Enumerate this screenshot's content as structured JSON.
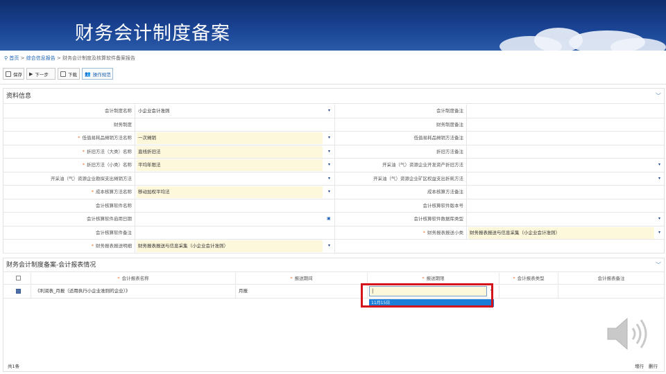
{
  "slide": {
    "title": "财务会计制度备案"
  },
  "breadcrumb": {
    "home": "首页",
    "sep": ">",
    "level1": "综合信息报告",
    "level2": "财务会计制度及核算软件备案报告"
  },
  "toolbar": {
    "save": "保存",
    "next": "下一步",
    "download": "下载",
    "guide": "操作规范"
  },
  "section1": {
    "title": "资料信息"
  },
  "form": [
    {
      "l1": "会计制度名称",
      "r1": false,
      "v1": "小企业会计准则",
      "y1": false,
      "dd1": true,
      "l2": "会计制度备注",
      "r2": false,
      "v2": "",
      "y2": false,
      "dd2": false
    },
    {
      "l1": "财务制度",
      "r1": false,
      "v1": "",
      "y1": false,
      "dd1": false,
      "l2": "财务制度备注",
      "r2": false,
      "v2": "",
      "y2": false,
      "dd2": false
    },
    {
      "l1": "低值易耗品摊销方法名称",
      "r1": true,
      "v1": "一次摊销",
      "y1": true,
      "dd1": true,
      "l2": "低值易耗品摊销方法备注",
      "r2": false,
      "v2": "",
      "y2": false,
      "dd2": false
    },
    {
      "l1": "折旧方法（大类）名称",
      "r1": true,
      "v1": "直线折旧法",
      "y1": true,
      "dd1": true,
      "l2": "折旧方法备注",
      "r2": false,
      "v2": "",
      "y2": false,
      "dd2": false
    },
    {
      "l1": "折旧方法（小类）名称",
      "r1": true,
      "v1": "平均年限法",
      "y1": true,
      "dd1": true,
      "l2": "开采油（气）资源企业开发资产折旧方法",
      "r2": false,
      "v2": "",
      "y2": false,
      "dd2": true
    },
    {
      "l1": "开采油（气）资源企业勘探支出摊销方法",
      "r1": false,
      "v1": "",
      "y1": false,
      "dd1": true,
      "l2": "开采油（气）资源企业矿区权益支出折耗方法",
      "r2": false,
      "v2": "",
      "y2": false,
      "dd2": true
    },
    {
      "l1": "成本核算方法名称",
      "r1": true,
      "v1": "移动加权平均法",
      "y1": true,
      "dd1": true,
      "l2": "成本核算方法备注",
      "r2": false,
      "v2": "",
      "y2": false,
      "dd2": false
    },
    {
      "l1": "会计核算软件名称",
      "r1": false,
      "v1": "",
      "y1": false,
      "dd1": false,
      "l2": "会计核算软件版本号",
      "r2": false,
      "v2": "",
      "y2": false,
      "dd2": false
    },
    {
      "l1": "会计核算软件启用日期",
      "r1": false,
      "v1": "",
      "y1": false,
      "dd1": false,
      "cal1": true,
      "l2": "会计核算软件数据库类型",
      "r2": false,
      "v2": "",
      "y2": false,
      "dd2": true
    },
    {
      "l1": "会计核算软件备注",
      "r1": false,
      "v1": "",
      "y1": false,
      "dd1": false,
      "l2": "财务报表报送小类",
      "r2": true,
      "v2": "财务报表报送与信息采集（小企业会计准则）",
      "y2": true,
      "dd2": true
    },
    {
      "l1": "财务报表报送明细",
      "r1": true,
      "v1": "财务报表报送与信息采集（小企业会计准则）",
      "y1": true,
      "dd1": true,
      "l2": "",
      "r2": false,
      "v2": "",
      "y2": false,
      "dd2": false,
      "half": true
    }
  ],
  "section2": {
    "title": "财务会计制度备案-会计报表情况"
  },
  "grid": {
    "headers": {
      "name": "会计报表名称",
      "period": "报送期间",
      "deadline": "报送期限",
      "type": "会计报表类型",
      "remark": "会计报表备注"
    },
    "rows": [
      {
        "name": "《利润表_月报（适用执行小企业准则的企业）》",
        "period": "月报",
        "deadline": "",
        "type": "",
        "remark": ""
      }
    ],
    "dropdown_option": "11月15日",
    "total": "共1条",
    "add_row": "增行",
    "delete_row": "删行"
  },
  "icons": {
    "dropdown": "▾",
    "chevron": "﹀"
  }
}
